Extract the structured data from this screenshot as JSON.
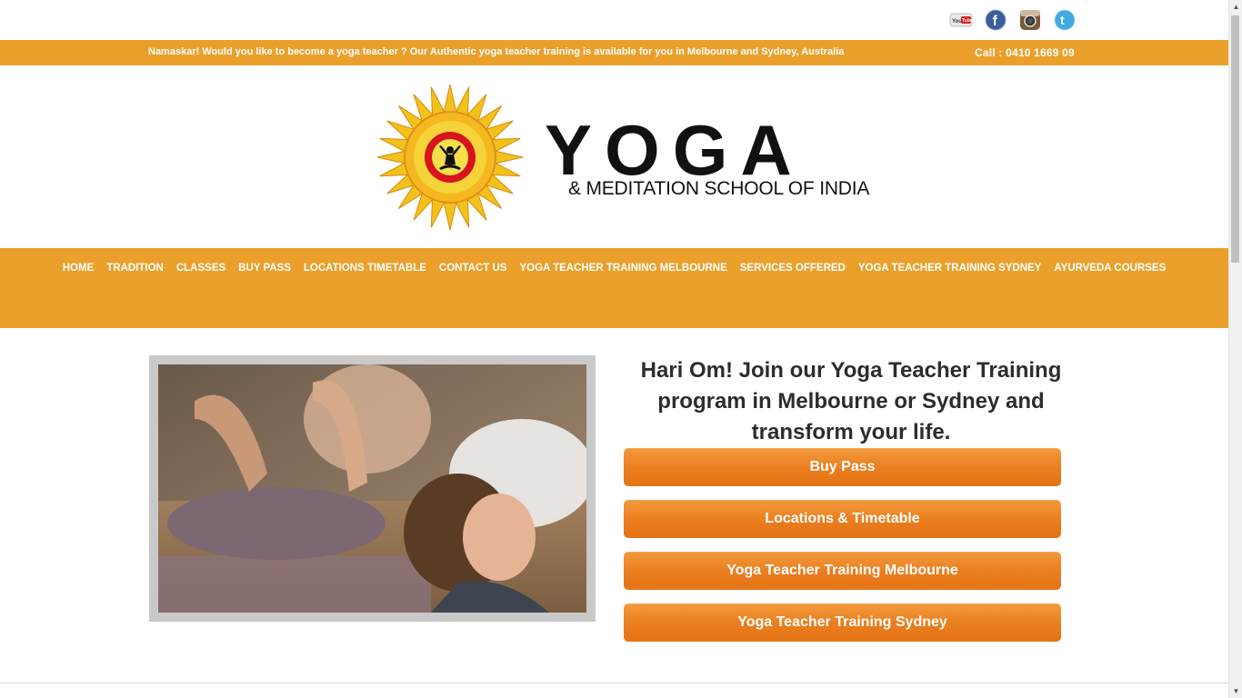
{
  "social": {
    "icons": [
      "youtube-icon",
      "facebook-icon",
      "instagram-icon",
      "twitter-icon"
    ],
    "youtube_text": "You Tube"
  },
  "announcement": {
    "message": "Namaskar! Would you like to become a yoga teacher ? Our Authentic yoga teacher training is available for you in Melbourne and Sydney, Australia",
    "phone": "Call : 0410 1669 09"
  },
  "logo": {
    "word": "YOGA",
    "tagline": "& MEDITATION SCHOOL OF INDIA"
  },
  "nav": {
    "items": [
      "HOME",
      "TRADITION",
      "CLASSES",
      "BUY PASS",
      "LOCATIONS TIMETABLE",
      "CONTACT US",
      "YOGA TEACHER TRAINING MELBOURNE",
      "SERVICES OFFERED",
      "YOGA TEACHER TRAINING SYDNEY",
      "AYURVEDA COURSES"
    ]
  },
  "hero": {
    "headline": "Hari Om! Join our Yoga Teacher Training program in Melbourne or Sydney and transform your life.",
    "buttons": [
      "Buy Pass",
      "Locations & Timetable",
      "Yoga Teacher Training Melbourne",
      "Yoga Teacher Training Sydney"
    ]
  },
  "colors": {
    "accent": "#eba02c",
    "button": "#ea7d1e"
  }
}
